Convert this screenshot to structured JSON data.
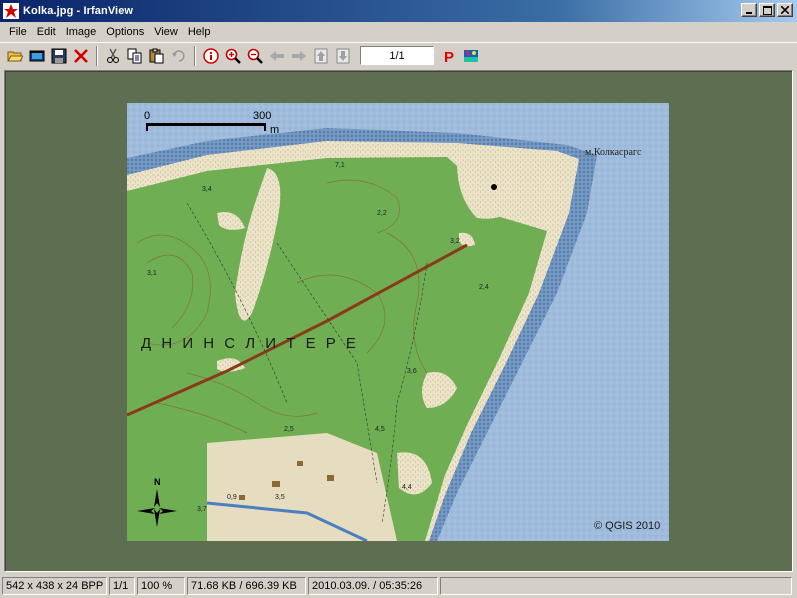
{
  "window": {
    "title": "Kolka.jpg - IrfanView",
    "controls": [
      "minimize",
      "maximize",
      "close"
    ]
  },
  "menu": [
    "File",
    "Edit",
    "Image",
    "Options",
    "View",
    "Help"
  ],
  "toolbar": {
    "page_indicator": "1/1",
    "icons": [
      "open-folder-icon",
      "slideshow-icon",
      "save-icon",
      "delete-icon",
      "cut-icon",
      "copy-icon",
      "paste-icon",
      "undo-icon",
      "info-icon",
      "zoom-in-icon",
      "zoom-out-icon",
      "previous-icon",
      "next-icon",
      "first-icon",
      "last-icon",
      "print-icon",
      "paint-icon"
    ]
  },
  "map": {
    "scale_start": "0",
    "scale_end": "300",
    "scale_unit": "m",
    "place_label": "м.Колкасрагс",
    "region_label": "Д Н И Н  С Л И Т Е Р Е",
    "copyright": "© QGIS 2010",
    "north_label": "N",
    "spot_heights": [
      "3,2",
      "2,4",
      "3,1",
      "3,6",
      "7,1",
      "3,5",
      "0,9",
      "3,7",
      "2,5",
      "4,5",
      "4,4",
      "3,4",
      "2,2"
    ]
  },
  "status": {
    "dimensions": "542 x 438 x 24 BPP",
    "page": "1/1",
    "zoom": "100 %",
    "filesize": "71.68 KB / 696.39 KB",
    "datetime": "2010.03.09. / 05:35:26",
    "extra": ""
  }
}
